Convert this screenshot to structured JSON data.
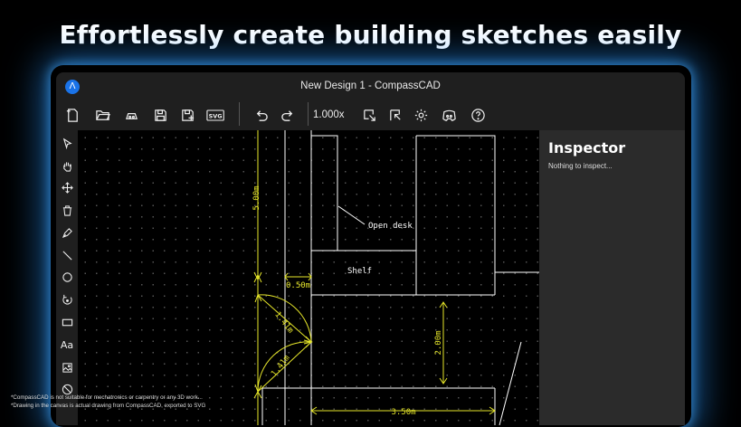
{
  "headline": "Effortlessly create building sketches easily",
  "window": {
    "title": "New Design 1 - CompassCAD",
    "logo_glyph": "Λ"
  },
  "toolbar": {
    "zoom": "1.000x",
    "svg_label": "SVG",
    "items": [
      "new-file-icon",
      "open-folder-icon",
      "open-cloud-icon",
      "save-icon",
      "save-as-icon",
      "export-svg-icon",
      "undo-icon",
      "redo-icon",
      "zoom-level",
      "import-icon",
      "export-icon",
      "settings-icon",
      "discord-icon",
      "help-icon"
    ]
  },
  "sidebar": {
    "text_tool": "Aa",
    "items": [
      "select-cursor-icon",
      "pan-hand-icon",
      "move-icon",
      "delete-icon",
      "pen-icon",
      "line-icon",
      "circle-icon",
      "rotate-icon",
      "rectangle-icon",
      "text-icon",
      "image-icon",
      "hatch-icon"
    ]
  },
  "drawing": {
    "labels": {
      "open_desk": "Open desk",
      "shelf": "Shelf"
    },
    "dimensions": {
      "d1": "5.00m",
      "d2": "0.50m",
      "d3": "1.41m",
      "d4": "1.41m",
      "d5": "2.00m",
      "d6": "3.50m"
    }
  },
  "inspector": {
    "title": "Inspector",
    "empty_text": "Nothing to inspect..."
  },
  "footnotes": [
    "*CompassCAD is not suitable for mechatronics or carpentry or any 3D work...",
    "*Drawing in the canvas is actual drawing from CompassCAD, exported to SVG"
  ],
  "colors": {
    "accent": "#1a73e8",
    "dimension": "#e6e62a",
    "glow": "#2896ff"
  }
}
